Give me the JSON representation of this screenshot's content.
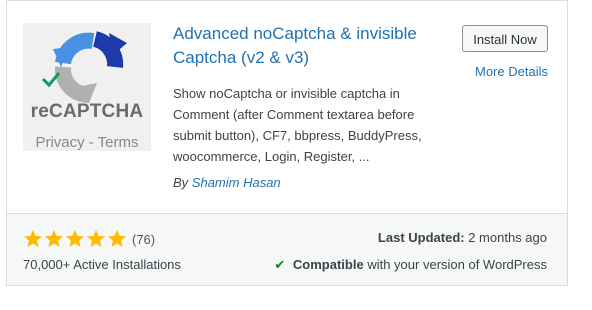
{
  "plugin": {
    "name": "Advanced noCaptcha & invisible Captcha (v2 & v3)",
    "description": "Show noCaptcha or invisible captcha in Comment (after Comment textarea before submit button), CF7, bbpress, BuddyPress, woocommerce, Login, Register, ...",
    "author_prefix": "By",
    "author_name": "Shamim Hasan",
    "icon": {
      "brand_text": "reCAPTCHA",
      "sub_text": "Privacy - Terms",
      "colors": {
        "blue": "#4a90e2",
        "dark_blue": "#1c3aa9",
        "gray": "#b0b0b0",
        "check": "#0f9d58"
      }
    }
  },
  "actions": {
    "install_label": "Install Now",
    "more_details_label": "More Details"
  },
  "stats": {
    "rating_value": 5,
    "rating_max": 5,
    "rating_count": "(76)",
    "active_installs": "70,000+ Active Installations",
    "last_updated_label": "Last Updated:",
    "last_updated_value": "2 months ago",
    "compat_strong": "Compatible",
    "compat_rest": "with your version of WordPress",
    "compat_icon": "checkmark-icon",
    "star_color": "#ffb900"
  }
}
